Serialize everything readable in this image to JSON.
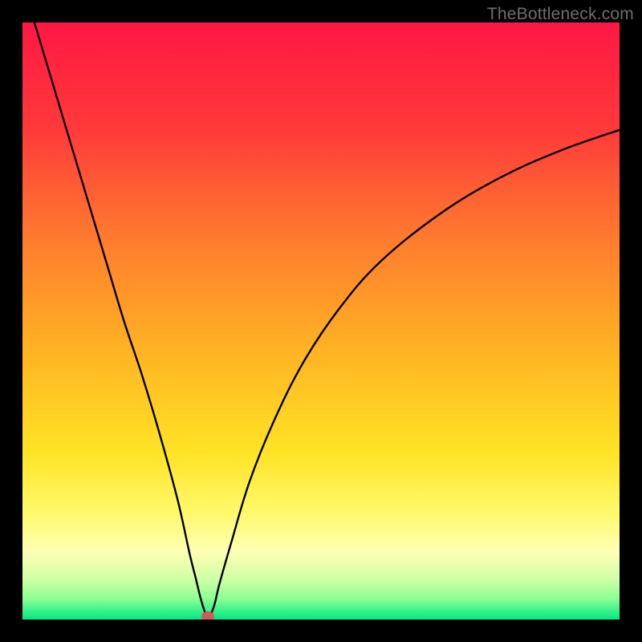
{
  "watermark": {
    "text": "TheBottleneck.com"
  },
  "colors": {
    "frame": "#000000",
    "curve": "#000000",
    "marker": "#d1595a",
    "gradient_stops": [
      {
        "offset": 0.0,
        "color": "#ff1744"
      },
      {
        "offset": 0.18,
        "color": "#ff3a3a"
      },
      {
        "offset": 0.36,
        "color": "#ff7a2f"
      },
      {
        "offset": 0.55,
        "color": "#ffb323"
      },
      {
        "offset": 0.72,
        "color": "#ffe325"
      },
      {
        "offset": 0.82,
        "color": "#fff96a"
      },
      {
        "offset": 0.885,
        "color": "#ffffb3"
      },
      {
        "offset": 0.93,
        "color": "#d3ffa7"
      },
      {
        "offset": 0.965,
        "color": "#8bff93"
      },
      {
        "offset": 1.0,
        "color": "#00e884"
      }
    ]
  },
  "chart_data": {
    "type": "line",
    "title": "",
    "xlabel": "",
    "ylabel": "",
    "xlim": [
      0,
      100
    ],
    "ylim": [
      0,
      100
    ],
    "optimum_x": 31,
    "series": [
      {
        "name": "bottleneck-curve",
        "x": [
          2,
          5,
          8,
          11,
          14,
          17,
          20,
          23,
          26,
          28,
          29,
          30,
          31,
          32,
          33,
          35,
          38,
          42,
          47,
          53,
          60,
          70,
          80,
          90,
          100
        ],
        "values": [
          100,
          90,
          80,
          70,
          60,
          50,
          41,
          31,
          20,
          11,
          7,
          3,
          0.5,
          2,
          6,
          13,
          23,
          33,
          43,
          52,
          60,
          68,
          74,
          78.5,
          82
        ]
      }
    ],
    "annotations": [
      {
        "name": "optimum-marker",
        "x": 31,
        "y": 0.5
      }
    ]
  }
}
